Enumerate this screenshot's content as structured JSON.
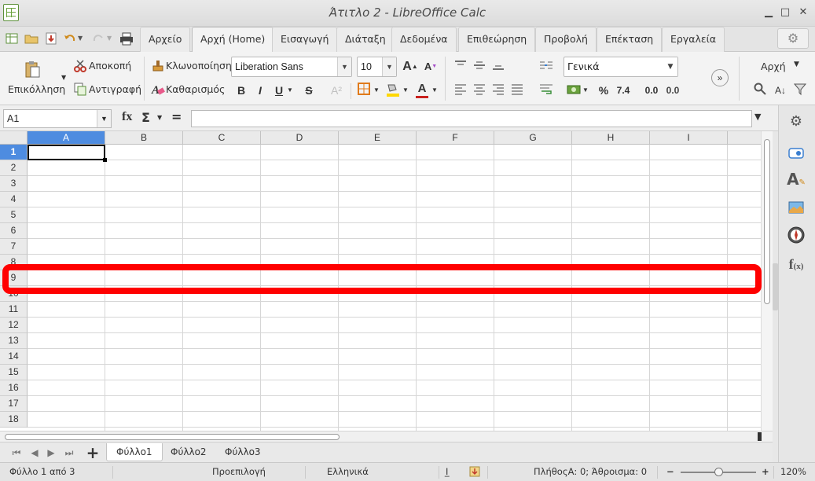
{
  "window": {
    "title": "Άτιτλο 2 - LibreOffice Calc",
    "minimize": "▁",
    "maximize": "□",
    "close": "✕"
  },
  "tabs": [
    {
      "label": "Αρχείο"
    },
    {
      "label": "Αρχή (Home)"
    },
    {
      "label": "Εισαγωγή"
    },
    {
      "label": "Διάταξη"
    },
    {
      "label": "Δεδομένα"
    },
    {
      "label": "Επιθεώρηση"
    },
    {
      "label": "Προβολή"
    },
    {
      "label": "Επέκταση"
    },
    {
      "label": "Εργαλεία"
    }
  ],
  "toolbar": {
    "paste": "Επικόλληση",
    "cut": "Αποκοπή",
    "copy": "Αντιγραφή",
    "clone": "Κλωνοποίηση",
    "clear": "Καθαρισμός",
    "font_name": "Liberation Sans",
    "font_size": "10",
    "number_format": "Γενικά",
    "percent": "%",
    "number": "7.4",
    "add_decimal": "0.0",
    "del_decimal": "0.0",
    "start_label": "Αρχή",
    "bold": "B",
    "italic": "I",
    "underline": "U",
    "strike": "S"
  },
  "formula_bar": {
    "name_box": "A1",
    "fx": "fx",
    "sigma": "Σ",
    "equals": "=",
    "content": ""
  },
  "grid": {
    "columns": [
      "A",
      "B",
      "C",
      "D",
      "E",
      "F",
      "G",
      "H",
      "I"
    ],
    "rows": [
      "1",
      "2",
      "3",
      "4",
      "5",
      "6",
      "7",
      "8",
      "9",
      "10",
      "11",
      "12",
      "13",
      "14",
      "15",
      "16",
      "17",
      "18"
    ],
    "selected_column": "A",
    "selected_row": "1",
    "highlighted_row": "9"
  },
  "sheets": [
    {
      "label": "Φύλλο1"
    },
    {
      "label": "Φύλλο2"
    },
    {
      "label": "Φύλλο3"
    }
  ],
  "status": {
    "sheet_info": "Φύλλο 1 από 3",
    "page_style": "Προεπιλογή",
    "language": "Ελληνικά",
    "selection_stats": "ΠλήθοςΑ: 0; Άθροισμα: 0",
    "zoom": "120%"
  },
  "colors": {
    "selection_blue": "#4e8ce0",
    "highlight_red": "#ff0000"
  }
}
